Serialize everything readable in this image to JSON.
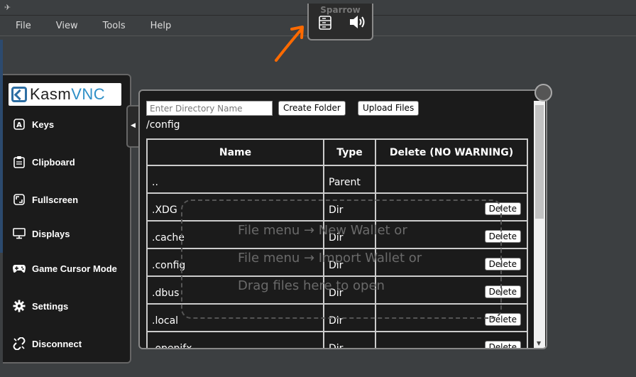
{
  "window": {
    "title": "Sparrow"
  },
  "menu": {
    "items": [
      "File",
      "View",
      "Tools",
      "Help"
    ]
  },
  "sidebar": {
    "logo_prefix": "Kasm",
    "logo_suffix": "VNC",
    "items": [
      {
        "label": "Keys",
        "icon": "keyboard-a-icon"
      },
      {
        "label": "Clipboard",
        "icon": "clipboard-icon"
      },
      {
        "label": "Fullscreen",
        "icon": "fullscreen-icon"
      },
      {
        "label": "Displays",
        "icon": "monitor-icon"
      },
      {
        "label": "Game Cursor Mode",
        "icon": "gamepad-icon"
      },
      {
        "label": "Settings",
        "icon": "gear-icon"
      },
      {
        "label": "Disconnect",
        "icon": "unlink-icon"
      }
    ]
  },
  "file_panel": {
    "input_placeholder": "Enter Directory Name",
    "create_folder_label": "Create Folder",
    "upload_files_label": "Upload Files",
    "current_path": "/config",
    "columns": [
      "Name",
      "Type",
      "Delete (NO WARNING)"
    ],
    "delete_label": "Delete",
    "rows": [
      {
        "name": "..",
        "type": "Parent",
        "deletable": false
      },
      {
        "name": ".XDG",
        "type": "Dir",
        "deletable": true
      },
      {
        "name": ".cache",
        "type": "Dir",
        "deletable": true
      },
      {
        "name": ".config",
        "type": "Dir",
        "deletable": true
      },
      {
        "name": ".dbus",
        "type": "Dir",
        "deletable": true
      },
      {
        "name": ".local",
        "type": "Dir",
        "deletable": true
      },
      {
        "name": ".openjfx",
        "type": "Dir",
        "deletable": true
      }
    ]
  },
  "drop_hint": {
    "line1": "File menu → New Wallet or",
    "line2": "File menu → Import Wallet or",
    "line3": "Drag files here to open"
  },
  "colors": {
    "annotation_arrow": "#ff6a00",
    "logo_accent": "#2d8fc7"
  }
}
